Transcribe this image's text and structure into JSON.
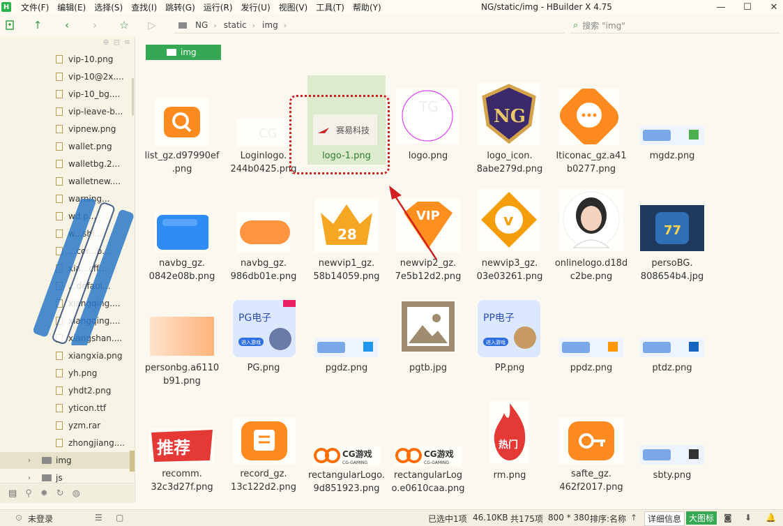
{
  "app": {
    "logo": "H",
    "window_title": "NG/static/img - HBuilder X 4.75",
    "menus": [
      "文件(F)",
      "编辑(E)",
      "选择(S)",
      "查找(I)",
      "跳转(G)",
      "运行(R)",
      "发行(U)",
      "视图(V)",
      "工具(T)",
      "帮助(Y)"
    ]
  },
  "pathbar": {
    "crumbs": [
      "NG",
      "static",
      "img"
    ]
  },
  "search": {
    "placeholder": "搜索 \"img\""
  },
  "sidebar": {
    "files": [
      "vip-10.png",
      "vip-10@2x....",
      "vip-10_bg....",
      "vip-leave-b...",
      "vipnew.png",
      "wallet.png",
      "walletbg.2...",
      "walletnew....",
      "warning...",
      "wd.p...",
      "w...shi...",
      "...cor...b...",
      "xia...cff...",
      "...defaul...",
      "xiangqing....",
      "xiangqing....",
      "xiangshan....",
      "xiangxia.png",
      "yh.png",
      "yhdt2.png",
      "yticon.ttf",
      "yzm.rar",
      "zhongjiang...."
    ],
    "folders": [
      {
        "name": "img",
        "selected": true
      },
      {
        "name": "js",
        "selected": false
      }
    ]
  },
  "folder_tab": {
    "label": "img"
  },
  "grid": [
    {
      "name": [
        "list_gz.d97990ef",
        ".png"
      ],
      "thumb": "search-orange"
    },
    {
      "name": [
        "Loginlogo.",
        "244b0425.png"
      ],
      "thumb": "cg-white"
    },
    {
      "name": [
        "logo-1.png"
      ],
      "thumb": "logo-sy",
      "selected": true
    },
    {
      "name": [
        "logo.png"
      ],
      "thumb": "circle-tg",
      "thumb_text": "TG"
    },
    {
      "name": [
        "logo_icon.",
        "8abe279d.png"
      ],
      "thumb": "ng-shield",
      "thumb_text": "NG"
    },
    {
      "name": [
        "lticonac_gz.a41",
        "b0277.png"
      ],
      "thumb": "chat-orange"
    },
    {
      "name": [
        "mgdz.png"
      ],
      "thumb": "banner"
    },
    {
      "name": [
        "navbg_gz.",
        "0842e08b.png"
      ],
      "thumb": "blue-rect"
    },
    {
      "name": [
        "navbg_gz.",
        "986db01e.png"
      ],
      "thumb": "orange-pill"
    },
    {
      "name": [
        "newvip1_gz.",
        "58b14059.png"
      ],
      "thumb": "crown-28",
      "thumb_text": "28"
    },
    {
      "name": [
        "newvip2_gz.",
        "7e5b12d2.png"
      ],
      "thumb": "vip-gem",
      "thumb_text": "VIP"
    },
    {
      "name": [
        "newvip3_gz.",
        "03e03261.png"
      ],
      "thumb": "v-badge",
      "thumb_text": "v"
    },
    {
      "name": [
        "onlinelogo.d18d",
        "c2be.png"
      ],
      "thumb": "avatar"
    },
    {
      "name": [
        "persoBG.",
        "808654b4.jpg"
      ],
      "thumb": "slot"
    },
    {
      "name": [
        "personbg.a6110",
        "b91.png"
      ],
      "thumb": "peach-rect"
    },
    {
      "name": [
        "PG.png"
      ],
      "thumb": "pg-card",
      "thumb_text": "PG电子",
      "thumb_sub": "进入游戏"
    },
    {
      "name": [
        "pgdz.png"
      ],
      "thumb": "banner"
    },
    {
      "name": [
        "pgtb.jpg"
      ],
      "thumb": "image-placeholder"
    },
    {
      "name": [
        "PP.png"
      ],
      "thumb": "pp-card",
      "thumb_text": "PP电子",
      "thumb_sub": "进入游戏"
    },
    {
      "name": [
        "ppdz.png"
      ],
      "thumb": "banner"
    },
    {
      "name": [
        "ptdz.png"
      ],
      "thumb": "banner"
    },
    {
      "name": [
        "recomm.",
        "32c3d27f.png"
      ],
      "thumb": "tuijian",
      "thumb_text": "推荐"
    },
    {
      "name": [
        "record_gz.",
        "13c122d2.png"
      ],
      "thumb": "record-orange"
    },
    {
      "name": [
        "rectangularLogo.",
        "9d851923.png"
      ],
      "thumb": "cg-gaming",
      "thumb_text": "CG游戏",
      "thumb_sub": "CG-GAMING"
    },
    {
      "name": [
        "rectangularLog",
        "o.e0610caa.png"
      ],
      "thumb": "cg-gaming",
      "thumb_text": "CG游戏",
      "thumb_sub": "CG-GAMING"
    },
    {
      "name": [
        "rm.png"
      ],
      "thumb": "fire",
      "thumb_text": "热门"
    },
    {
      "name": [
        "safte_gz.",
        "462f2017.png"
      ],
      "thumb": "key-orange"
    },
    {
      "name": [
        "sbty.png"
      ],
      "thumb": "banner"
    }
  ],
  "status": {
    "login": "未登录",
    "selected": "已选中1项",
    "size": "46.10KB",
    "total": "共175项",
    "dimensions": "800 * 380",
    "sort": "排序:名称",
    "detail": "详细信息",
    "large": "大图标"
  },
  "colors": {
    "accent": "#34a853",
    "selection": "#dcebcb",
    "annotation": "#d11f1f"
  }
}
